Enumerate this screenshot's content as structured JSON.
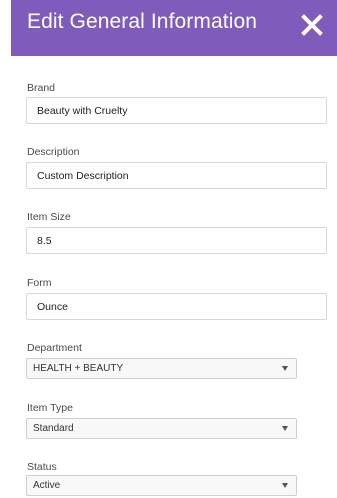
{
  "header": {
    "title": "Edit General Information",
    "close_icon": "close-icon",
    "background_color": "#7f5bbb"
  },
  "fields": {
    "brand": {
      "label": "Brand",
      "value": "Beauty with Cruelty"
    },
    "description": {
      "label": "Description",
      "value": "Custom Description"
    },
    "item_size": {
      "label": "Item Size",
      "value": "8.5"
    },
    "form": {
      "label": "Form",
      "value": "Ounce"
    },
    "department": {
      "label": "Department",
      "value": "HEALTH + BEAUTY",
      "icon": "chevron-down-icon"
    },
    "item_type": {
      "label": "Item Type",
      "value": "Standard",
      "icon": "chevron-down-icon"
    },
    "status": {
      "label": "Status",
      "value": "Active",
      "icon": "chevron-down-icon"
    }
  }
}
